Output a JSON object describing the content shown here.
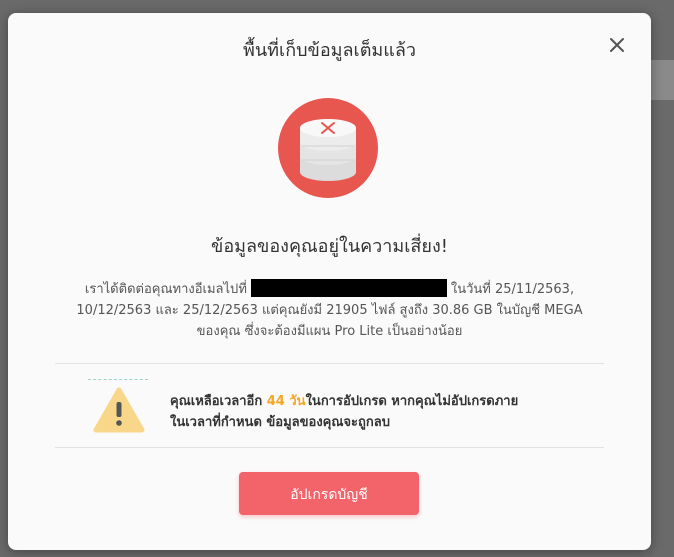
{
  "dialog": {
    "title": "พื้นที่เก็บข้อมูลเต็มแล้ว",
    "close_icon": "close-icon",
    "illustration_icon": "storage-full-icon",
    "headline": "ข้อมูลของคุณอยู่ในความเสี่ยง!",
    "body": {
      "part1": "เราได้ติดต่อคุณทางอีเมลไปที่",
      "part2": "ในวันที่ 25/11/2563,",
      "line2": "10/12/2563 และ 25/12/2563 แต่คุณยังมี 21905 ไฟล์ สูงถึง 30.86 GB ในบัญชี MEGA",
      "line3": "ของคุณ ซึ่งจะต้องมีแผน Pro Lite เป็นอย่างน้อย"
    },
    "warning": {
      "icon": "warning-icon",
      "prefix": "คุณเหลือเวลาอีก ",
      "days": "44 วัน",
      "suffix": "ในการอัปเกรด หากคุณไม่อัปเกรดภาย",
      "line2": "ในเวลาที่กำหนด ข้อมูลของคุณจะถูกลบ"
    },
    "upgrade_button_label": "อัปเกรดบัญชี"
  },
  "colors": {
    "accent": "#f2636a",
    "days_highlight": "#f5a623"
  }
}
